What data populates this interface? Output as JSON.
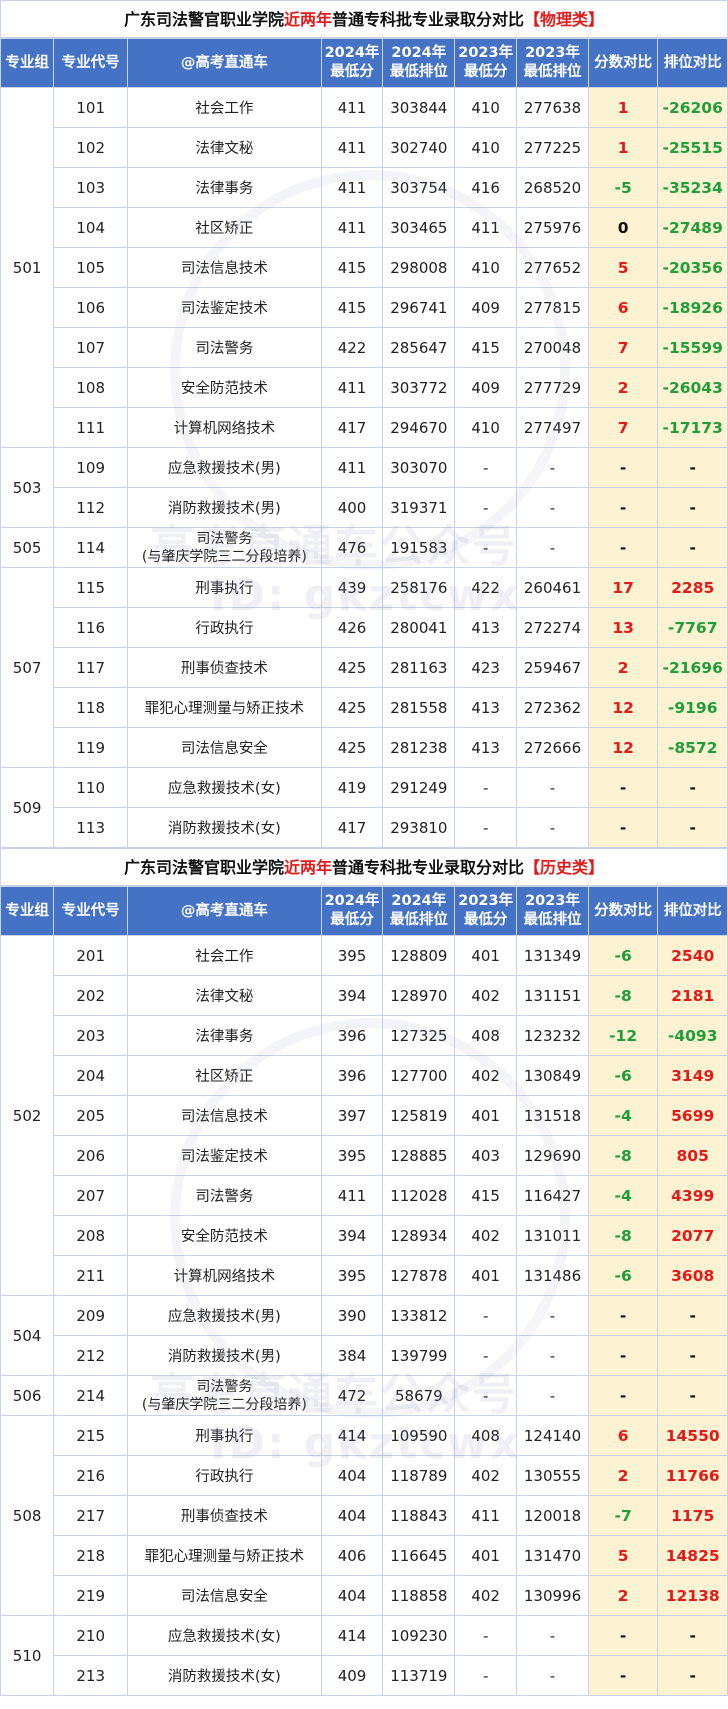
{
  "sections": [
    {
      "title_pre": "广东司法警官职业学院",
      "title_hl": "近两年",
      "title_mid": "普通专科批专业录取分对比",
      "title_tag": "【物理类】",
      "headers": [
        "专业组",
        "专业代号",
        "@高考直通车",
        "2024年\n最低分",
        "2024年\n最低排位",
        "2023年\n最低分",
        "2023年\n最低排位",
        "分数对比",
        "排位对比"
      ],
      "groups": [
        {
          "group": "501",
          "rows": [
            [
              "101",
              "社会工作",
              "411",
              "303844",
              "410",
              "277638",
              "1",
              "-26206"
            ],
            [
              "102",
              "法律文秘",
              "411",
              "302740",
              "410",
              "277225",
              "1",
              "-25515"
            ],
            [
              "103",
              "法律事务",
              "411",
              "303754",
              "416",
              "268520",
              "-5",
              "-35234"
            ],
            [
              "104",
              "社区矫正",
              "411",
              "303465",
              "411",
              "275976",
              "0",
              "-27489"
            ],
            [
              "105",
              "司法信息技术",
              "415",
              "298008",
              "410",
              "277652",
              "5",
              "-20356"
            ],
            [
              "106",
              "司法鉴定技术",
              "415",
              "296741",
              "409",
              "277815",
              "6",
              "-18926"
            ],
            [
              "107",
              "司法警务",
              "422",
              "285647",
              "415",
              "270048",
              "7",
              "-15599"
            ],
            [
              "108",
              "安全防范技术",
              "411",
              "303772",
              "409",
              "277729",
              "2",
              "-26043"
            ],
            [
              "111",
              "计算机网络技术",
              "417",
              "294670",
              "410",
              "277497",
              "7",
              "-17173"
            ]
          ]
        },
        {
          "group": "503",
          "rows": [
            [
              "109",
              "应急救援技术(男)",
              "411",
              "303070",
              "-",
              "-",
              "-",
              "-"
            ],
            [
              "112",
              "消防救援技术(男)",
              "400",
              "319371",
              "-",
              "-",
              "-",
              "-"
            ]
          ]
        },
        {
          "group": "505",
          "rows": [
            [
              "114",
              "司法警务\n(与肇庆学院三二分段培养)",
              "476",
              "191583",
              "-",
              "-",
              "-",
              "-"
            ]
          ]
        },
        {
          "group": "507",
          "rows": [
            [
              "115",
              "刑事执行",
              "439",
              "258176",
              "422",
              "260461",
              "17",
              "2285"
            ],
            [
              "116",
              "行政执行",
              "426",
              "280041",
              "413",
              "272274",
              "13",
              "-7767"
            ],
            [
              "117",
              "刑事侦查技术",
              "425",
              "281163",
              "423",
              "259467",
              "2",
              "-21696"
            ],
            [
              "118",
              "罪犯心理测量与矫正技术",
              "425",
              "281558",
              "413",
              "272362",
              "12",
              "-9196"
            ],
            [
              "119",
              "司法信息安全",
              "425",
              "281238",
              "413",
              "272666",
              "12",
              "-8572"
            ]
          ]
        },
        {
          "group": "509",
          "rows": [
            [
              "110",
              "应急救援技术(女)",
              "419",
              "291249",
              "-",
              "-",
              "-",
              "-"
            ],
            [
              "113",
              "消防救援技术(女)",
              "417",
              "293810",
              "-",
              "-",
              "-",
              "-"
            ]
          ]
        }
      ]
    },
    {
      "title_pre": "广东司法警官职业学院",
      "title_hl": "近两年",
      "title_mid": "普通专科批专业录取分对比",
      "title_tag": "【历史类】",
      "headers": [
        "专业组",
        "专业代号",
        "@高考直通车",
        "2024年\n最低分",
        "2024年\n最低排位",
        "2023年\n最低分",
        "2023年\n最低排位",
        "分数对比",
        "排位对比"
      ],
      "groups": [
        {
          "group": "502",
          "rows": [
            [
              "201",
              "社会工作",
              "395",
              "128809",
              "401",
              "131349",
              "-6",
              "2540"
            ],
            [
              "202",
              "法律文秘",
              "394",
              "128970",
              "402",
              "131151",
              "-8",
              "2181"
            ],
            [
              "203",
              "法律事务",
              "396",
              "127325",
              "408",
              "123232",
              "-12",
              "-4093"
            ],
            [
              "204",
              "社区矫正",
              "396",
              "127700",
              "402",
              "130849",
              "-6",
              "3149"
            ],
            [
              "205",
              "司法信息技术",
              "397",
              "125819",
              "401",
              "131518",
              "-4",
              "5699"
            ],
            [
              "206",
              "司法鉴定技术",
              "395",
              "128885",
              "403",
              "129690",
              "-8",
              "805"
            ],
            [
              "207",
              "司法警务",
              "411",
              "112028",
              "415",
              "116427",
              "-4",
              "4399"
            ],
            [
              "208",
              "安全防范技术",
              "394",
              "128934",
              "402",
              "131011",
              "-8",
              "2077"
            ],
            [
              "211",
              "计算机网络技术",
              "395",
              "127878",
              "401",
              "131486",
              "-6",
              "3608"
            ]
          ]
        },
        {
          "group": "504",
          "rows": [
            [
              "209",
              "应急救援技术(男)",
              "390",
              "133812",
              "-",
              "-",
              "-",
              "-"
            ],
            [
              "212",
              "消防救援技术(男)",
              "384",
              "139799",
              "-",
              "-",
              "-",
              "-"
            ]
          ]
        },
        {
          "group": "506",
          "rows": [
            [
              "214",
              "司法警务\n(与肇庆学院三二分段培养)",
              "472",
              "58679",
              "-",
              "-",
              "-",
              "-"
            ]
          ]
        },
        {
          "group": "508",
          "rows": [
            [
              "215",
              "刑事执行",
              "414",
              "109590",
              "408",
              "124140",
              "6",
              "14550"
            ],
            [
              "216",
              "行政执行",
              "404",
              "118789",
              "402",
              "130555",
              "2",
              "11766"
            ],
            [
              "217",
              "刑事侦查技术",
              "404",
              "118843",
              "411",
              "120018",
              "-7",
              "1175"
            ],
            [
              "218",
              "罪犯心理测量与矫正技术",
              "406",
              "116645",
              "401",
              "131470",
              "5",
              "14825"
            ],
            [
              "219",
              "司法信息安全",
              "404",
              "118858",
              "402",
              "130996",
              "2",
              "12138"
            ]
          ]
        },
        {
          "group": "510",
          "rows": [
            [
              "210",
              "应急救援技术(女)",
              "414",
              "109230",
              "-",
              "-",
              "-",
              "-"
            ],
            [
              "213",
              "消防救援技术(女)",
              "409",
              "113719",
              "-",
              "-",
              "-",
              "-"
            ]
          ]
        }
      ]
    }
  ],
  "watermark": {
    "line1": "高考直通车公众号",
    "line2": "ID: gkztcwx"
  },
  "colors": {
    "header_bg": "#4472c4",
    "compare_bg": "#fdf3d3",
    "up": "#e41a1a",
    "down": "#1f9e3a",
    "highlight": "#e41a1a"
  }
}
